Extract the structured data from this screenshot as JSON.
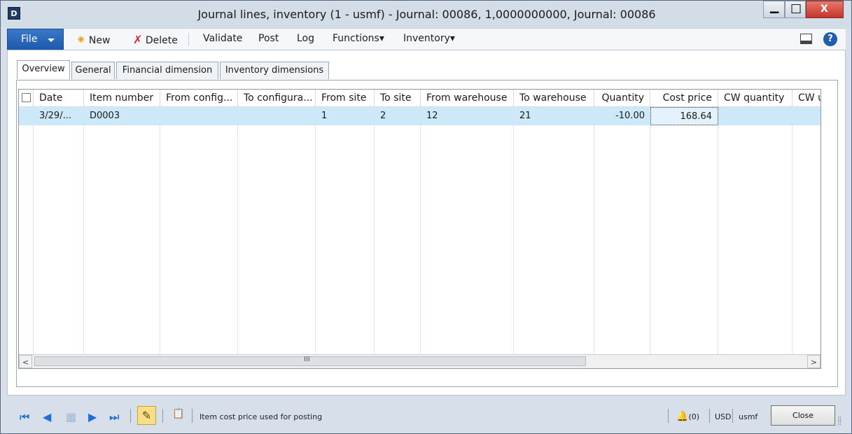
{
  "window": {
    "title": "Journal lines, inventory (1 - usmf) - Journal: 00086, 1,0000000000, Journal: 00086",
    "app_icon_text": "D",
    "minimize_glyph": "▁",
    "maximize_glyph": "□",
    "close_glyph": "X"
  },
  "menu": {
    "file": "File",
    "new": "New",
    "delete": "Delete",
    "validate": "Validate",
    "post": "Post",
    "log": "Log",
    "functions": "Functions",
    "inventory": "Inventory",
    "dropdown_glyph": "▾",
    "new_icon": "✷",
    "delete_icon": "✗",
    "help_icon": "?"
  },
  "tabs": [
    {
      "label": "Overview",
      "active": true
    },
    {
      "label": "General",
      "active": false
    },
    {
      "label": "Financial dimension",
      "active": false
    },
    {
      "label": "Inventory dimensions",
      "active": false
    }
  ],
  "grid": {
    "columns": [
      "Date",
      "Item number",
      "From config...",
      "To configura...",
      "From site",
      "To site",
      "From warehouse",
      "To warehouse",
      "Quantity",
      "Cost price",
      "CW quantity",
      "CW u"
    ],
    "rows": [
      {
        "date": "3/29/...",
        "item_number": "D0003",
        "from_config": "",
        "to_config": "",
        "from_site": "1",
        "to_site": "2",
        "from_warehouse": "12",
        "to_warehouse": "21",
        "quantity": "-10.00",
        "cost_price": "168.64",
        "cw_quantity": "",
        "cw_unit": ""
      }
    ],
    "scroll_left": "<",
    "scroll_right": ">",
    "scroll_grip": "III"
  },
  "status": {
    "first": "⏮",
    "prev": "◀",
    "grid_icon": "▦",
    "next": "▶",
    "last": "⏭",
    "edit_icon": "✎",
    "attach_icon": "📋",
    "message": "Item cost price used for posting",
    "bell_icon": "🔔",
    "notifications": "(0)",
    "currency": "USD",
    "company": "usmf",
    "close": "Close"
  }
}
